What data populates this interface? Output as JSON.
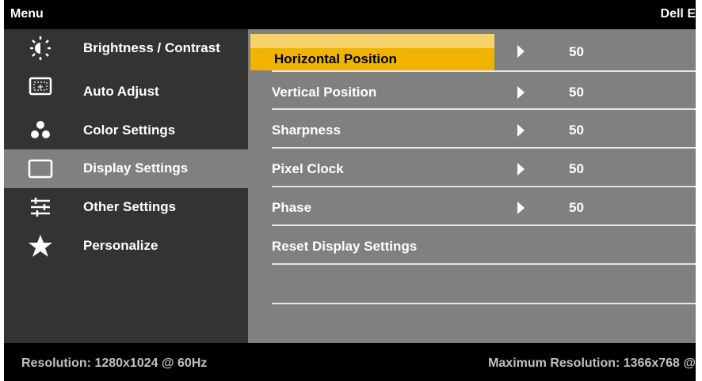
{
  "header": {
    "menu_title": "Menu",
    "brand": "Dell E"
  },
  "sidebar": {
    "items": [
      {
        "label": "Brightness / Contrast",
        "icon": "brightness-icon"
      },
      {
        "label": "Auto Adjust",
        "icon": "auto-adjust-icon"
      },
      {
        "label": "Color Settings",
        "icon": "color-settings-icon"
      },
      {
        "label": "Display Settings",
        "icon": "display-settings-icon",
        "active": true
      },
      {
        "label": "Other Settings",
        "icon": "other-settings-icon"
      },
      {
        "label": "Personalize",
        "icon": "star-icon"
      }
    ]
  },
  "display_settings": {
    "items": [
      {
        "label": "Horizontal Position",
        "value": "50",
        "selected": true
      },
      {
        "label": "Vertical Position",
        "value": "50"
      },
      {
        "label": "Sharpness",
        "value": "50"
      },
      {
        "label": "Pixel Clock",
        "value": "50"
      },
      {
        "label": "Phase",
        "value": "50"
      },
      {
        "label": "Reset Display Settings"
      }
    ]
  },
  "footer": {
    "resolution": "Resolution: 1280x1024 @ 60Hz",
    "max_resolution": "Maximum Resolution: 1366x768 @"
  },
  "colors": {
    "highlight": "#f0b400",
    "sidebar_bg": "#333333",
    "content_bg": "#808080"
  }
}
